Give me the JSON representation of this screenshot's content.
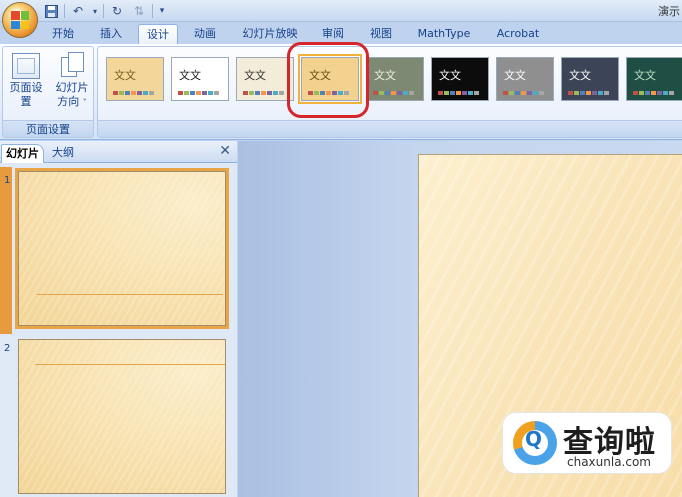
{
  "window": {
    "title_fragment": "演示"
  },
  "quick_access": {
    "icons": [
      "save-icon",
      "undo-icon",
      "redo-icon",
      "repeat-icon",
      "customize-icon"
    ]
  },
  "tabs": [
    {
      "label": "开始"
    },
    {
      "label": "插入"
    },
    {
      "label": "设计"
    },
    {
      "label": "动画"
    },
    {
      "label": "幻灯片放映"
    },
    {
      "label": "审阅"
    },
    {
      "label": "视图"
    },
    {
      "label": "MathType"
    },
    {
      "label": "Acrobat"
    }
  ],
  "ribbon": {
    "page_setup_group": {
      "page_setup_label": "页面设置",
      "orientation_label": "幻灯片",
      "orientation_label2": "方向",
      "orientation_arrow": "˅",
      "group_label": "页面设置"
    },
    "themes": [
      {
        "sample": "文文",
        "bg": "#f3d69a",
        "fg": "#7a5a1a"
      },
      {
        "sample": "文文",
        "bg": "#ffffff",
        "fg": "#1a1a1a"
      },
      {
        "sample": "文文",
        "bg": "#f3ecd8",
        "fg": "#333333"
      },
      {
        "sample": "文文",
        "bg": "#f2d28e",
        "fg": "#6b4c12"
      },
      {
        "sample": "文文",
        "bg": "#7e8974",
        "fg": "#f0f0e0"
      },
      {
        "sample": "文文",
        "bg": "#0c0c0c",
        "fg": "#ffffff"
      },
      {
        "sample": "文文",
        "bg": "#8f8f8f",
        "fg": "#ffffff"
      },
      {
        "sample": "文文",
        "bg": "#3c4558",
        "fg": "#ffffff"
      },
      {
        "sample": "文文",
        "bg": "#1f4f44",
        "fg": "#b8e0c8"
      }
    ]
  },
  "left_pane": {
    "tab_slides": "幻灯片",
    "tab_outline": "大纲",
    "close_glyph": "✕",
    "slides": [
      {
        "number": "1"
      },
      {
        "number": "2"
      }
    ]
  },
  "watermark": {
    "glyph": "Q",
    "cn": "查询啦",
    "en": "chaxunla.com"
  },
  "colors": {
    "highlight_ring": "#d7262b",
    "selection_orange": "#e89b3c",
    "ribbon_text": "#15428b"
  }
}
